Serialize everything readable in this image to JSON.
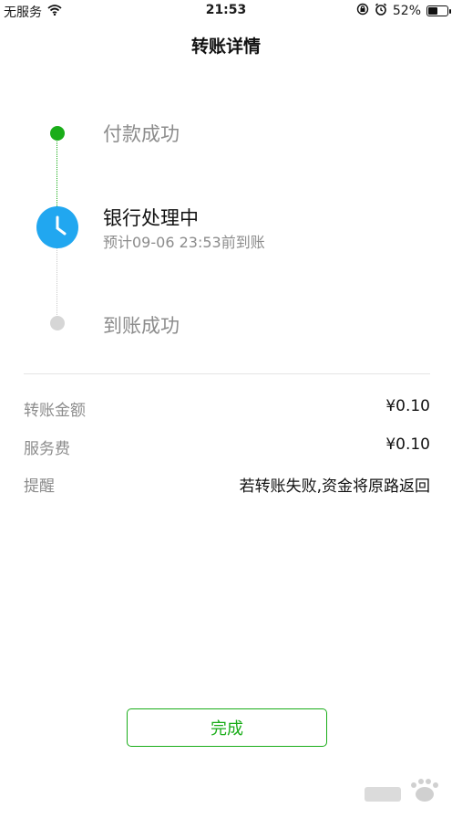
{
  "status_bar": {
    "carrier": "无服务",
    "time": "21:53",
    "battery": "52%",
    "battery_level": 0.52,
    "icons": [
      "wifi-icon",
      "orientation-lock-icon",
      "alarm-icon",
      "battery-icon"
    ]
  },
  "header": {
    "title": "转账详情"
  },
  "timeline": {
    "steps": [
      {
        "label": "付款成功",
        "state": "done",
        "color": "#1aad19"
      },
      {
        "label": "银行处理中",
        "sub": "预计09-06 23:53前到账",
        "state": "current",
        "color": "#21a7f0"
      },
      {
        "label": "到账成功",
        "state": "pending",
        "color": "#d6d6d6"
      }
    ]
  },
  "details": {
    "rows": [
      {
        "label": "转账金额",
        "value": "¥0.10"
      },
      {
        "label": "服务费",
        "value": "¥0.10"
      },
      {
        "label": "提醒",
        "value": "若转账失败,资金将原路返回"
      }
    ]
  },
  "footer": {
    "done_label": "完成"
  },
  "colors": {
    "accent_green": "#1aad19",
    "accent_blue": "#21a7f0",
    "muted_text": "#8c8c8c"
  }
}
